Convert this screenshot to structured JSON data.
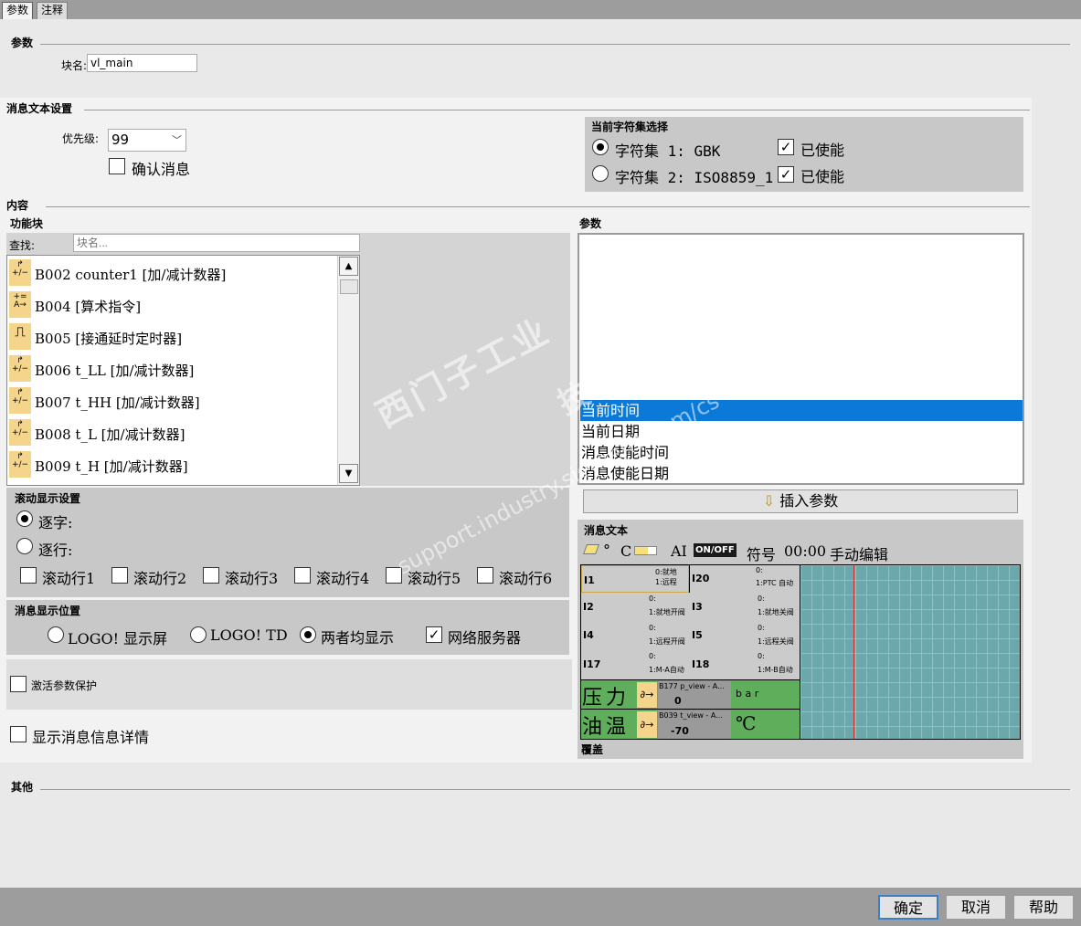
{
  "tabs": [
    "参数",
    "注释"
  ],
  "params_section": {
    "title": "参数",
    "block_name_label": "块名:",
    "block_name_value": "vl_main"
  },
  "msg_settings": {
    "title": "消息文本设置",
    "priority_label": "优先级:",
    "priority_value": "99",
    "ack_label": "确认消息",
    "ack_checked": false
  },
  "charset": {
    "title": "当前字符集选择",
    "set1_label": "字符集 1: GBK",
    "set2_label": "字符集 2: ISO8859_1",
    "set1_selected": true,
    "enabled1_label": "已使能",
    "enabled2_label": "已使能"
  },
  "content": {
    "title": "内容",
    "function_blocks_label": "功能块",
    "search_label": "查找:",
    "search_placeholder": "块名...",
    "blocks": [
      {
        "icon": "counter-icon",
        "text": "B002 counter1 [加/减计数器]"
      },
      {
        "icon": "math-icon",
        "text": "B004 [算术指令]"
      },
      {
        "icon": "timer-icon",
        "text": "B005 [接通延时定时器]"
      },
      {
        "icon": "counter-icon",
        "text": "B006 t_LL [加/减计数器]"
      },
      {
        "icon": "counter-icon",
        "text": "B007 t_HH [加/减计数器]"
      },
      {
        "icon": "counter-icon",
        "text": "B008 t_L [加/减计数器]"
      },
      {
        "icon": "counter-icon",
        "text": "B009 t_H [加/减计数器]"
      }
    ],
    "params_label": "参数",
    "param_items": [
      "当前时间",
      "当前日期",
      "消息使能时间",
      "消息使能日期"
    ],
    "param_selected": 0,
    "insert_param_label": "插入参数"
  },
  "scroll": {
    "title": "滚动显示设置",
    "char_label": "逐字:",
    "line_label": "逐行:",
    "lines": [
      "滚动行1",
      "滚动行2",
      "滚动行3",
      "滚动行4",
      "滚动行5",
      "滚动行6"
    ]
  },
  "position": {
    "title": "消息显示位置",
    "options": [
      "LOGO! 显示屏",
      "LOGO! TD",
      "两者均显示"
    ],
    "selected": 2,
    "web_label": "网络服务器",
    "web_checked": true
  },
  "protect_label": "激活参数保护",
  "details_label": "显示消息信息详情",
  "message_text": {
    "title": "消息文本",
    "toolbar": {
      "degree": "°",
      "celsius": "C",
      "ai": "AI",
      "onoff": "ON/OFF",
      "symbol": "符号",
      "time": "00:00",
      "manual": "手动编辑"
    },
    "cells": [
      {
        "name": "I1",
        "v0": "0:就地",
        "v1": "1:远程"
      },
      {
        "name": "I20",
        "v0": "0:",
        "v1": "1:PTC 自动"
      },
      {
        "name": "I2",
        "v0": "0:",
        "v1": "1:就地开阀"
      },
      {
        "name": "I3",
        "v0": "0:",
        "v1": "1:就地关阀"
      },
      {
        "name": "I4",
        "v0": "0:",
        "v1": "1:远程开阀"
      },
      {
        "name": "I5",
        "v0": "0:",
        "v1": "1:远程关阀"
      },
      {
        "name": "I17",
        "v0": "0:",
        "v1": "1:M-A自动"
      },
      {
        "name": "I18",
        "v0": "0:",
        "v1": "1:M-B自动"
      }
    ],
    "row_pressure": {
      "label": "压力",
      "block": "B177 p_view - A...",
      "value": "0",
      "unit": "b a r"
    },
    "row_oil": {
      "label": "油温",
      "block": "B039 t_view - A...",
      "value": "-70",
      "unit": "℃"
    },
    "overlay_label": "覆盖"
  },
  "other_label": "其他",
  "buttons": {
    "ok": "确定",
    "cancel": "取消",
    "help": "帮助"
  },
  "watermark": {
    "line1": "西门子工业",
    "line2": "技术论坛",
    "line3": "support.industry.siemens.com/cs"
  }
}
